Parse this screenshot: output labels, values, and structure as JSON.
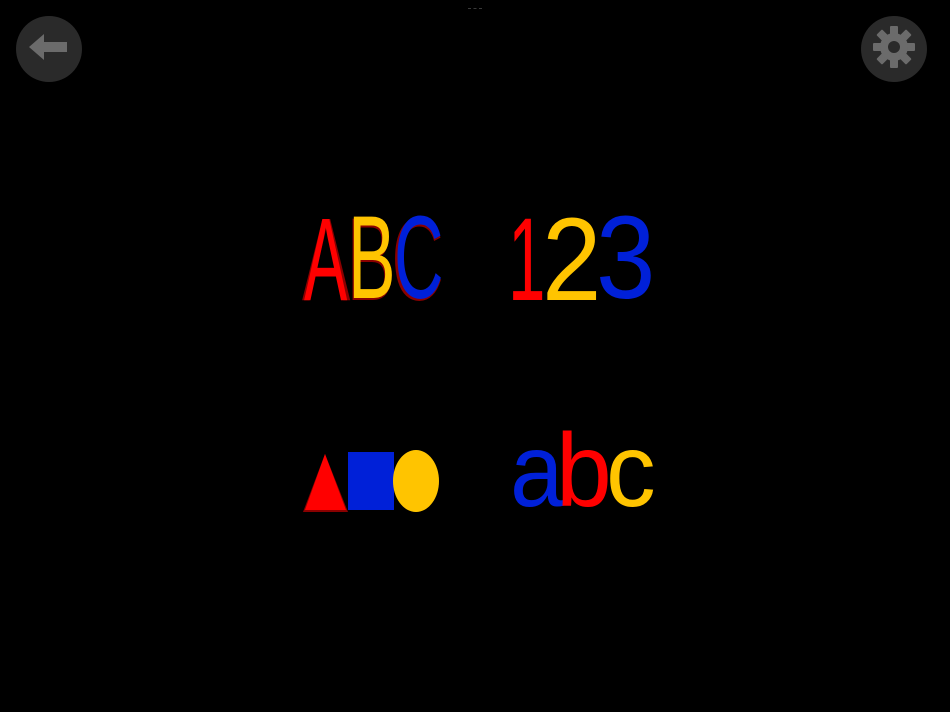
{
  "nav": {
    "back_icon": "arrow-left-icon",
    "settings_icon": "gear-icon"
  },
  "tiles": {
    "uppercase": {
      "letters": [
        "A",
        "B",
        "C"
      ]
    },
    "numbers": {
      "letters": [
        "1",
        "2",
        "3"
      ]
    },
    "shapes": {
      "items": [
        "triangle",
        "square",
        "circle"
      ]
    },
    "lowercase": {
      "letters": [
        "a",
        "b",
        "c"
      ]
    }
  },
  "colors": {
    "background": "#000000",
    "button": "#2a2a2a",
    "button_icon": "#6b6b6b",
    "red": "#ff0000",
    "yellow": "#ffc400",
    "blue": "#0020d8",
    "shadow": "#8a0000"
  }
}
